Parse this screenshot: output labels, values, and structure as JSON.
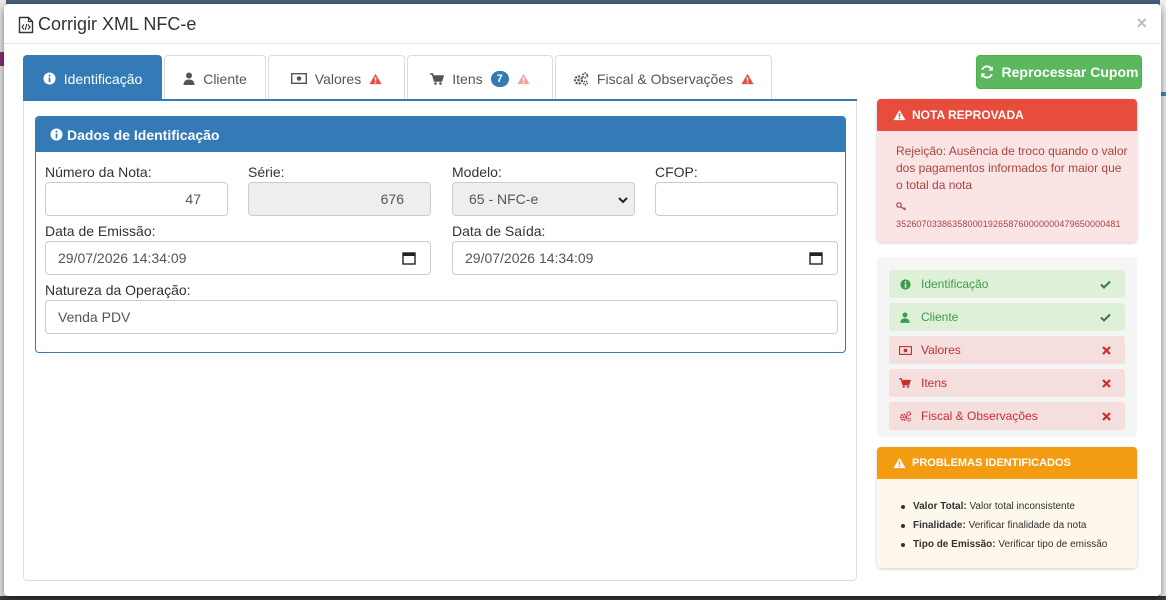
{
  "modal": {
    "title": "Corrigir XML NFC-e",
    "close": "×"
  },
  "tabs": [
    {
      "label": "Identificação",
      "active": true,
      "warning": false
    },
    {
      "label": "Cliente",
      "active": false,
      "warning": false
    },
    {
      "label": "Valores",
      "active": false,
      "warning": true
    },
    {
      "label": "Itens",
      "active": false,
      "warning": true,
      "badge": "7"
    },
    {
      "label": "Fiscal & Observações",
      "active": false,
      "warning": true
    }
  ],
  "identificacao": {
    "heading": "Dados de Identificação",
    "numero": {
      "label": "Número da Nota:",
      "value": "47"
    },
    "serie": {
      "label": "Série:",
      "value": "676"
    },
    "modelo": {
      "label": "Modelo:",
      "value": "65 - NFC-e"
    },
    "cfop": {
      "label": "CFOP:",
      "value": ""
    },
    "data_emissao": {
      "label": "Data de Emissão:",
      "value": "29/07/2026 14:34:09"
    },
    "data_saida": {
      "label": "Data de Saída:",
      "value": "29/07/2026 14:34:09"
    },
    "natureza": {
      "label": "Natureza da Operação:",
      "value": "Venda PDV"
    }
  },
  "reprocess_button": "Reprocessar Cupom",
  "nota_reprovada": {
    "title": "NOTA REPROVADA",
    "message": "Rejeição: Ausência de troco quando o valor dos pagamentos informados for maior que o total da nota",
    "chave": "35260703386358000192658760000000479650000481"
  },
  "status_list": [
    {
      "label": "Identificação",
      "ok": true
    },
    {
      "label": "Cliente",
      "ok": true
    },
    {
      "label": "Valores",
      "ok": false
    },
    {
      "label": "Itens",
      "ok": false
    },
    {
      "label": "Fiscal & Observações",
      "ok": false
    }
  ],
  "problemas": {
    "title": "PROBLEMAS IDENTIFICADOS",
    "items": [
      {
        "key": "Valor Total:",
        "text": "Valor total inconsistente"
      },
      {
        "key": "Finalidade:",
        "text": "Verificar finalidade da nota"
      },
      {
        "key": "Tipo de Emissão:",
        "text": "Verificar tipo de emissão"
      }
    ]
  },
  "colors": {
    "primary": "#337ab7",
    "success": "#5cb85c",
    "danger": "#e74c3c",
    "warning": "#f39c12"
  }
}
